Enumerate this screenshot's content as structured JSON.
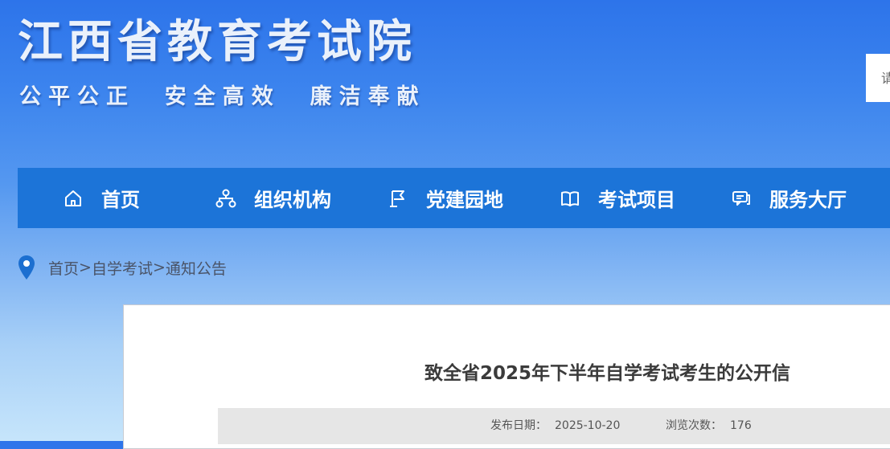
{
  "header": {
    "site_title": "江西省教育考试院",
    "slogan": "公平公正  安全高效  廉洁奉献",
    "search_placeholder": "请"
  },
  "nav": {
    "items": [
      {
        "label": "首页",
        "icon": "home-icon"
      },
      {
        "label": "组织机构",
        "icon": "org-chart-icon"
      },
      {
        "label": "党建园地",
        "icon": "party-flag-icon"
      },
      {
        "label": "考试项目",
        "icon": "book-icon"
      },
      {
        "label": "服务大厅",
        "icon": "service-icon"
      }
    ]
  },
  "breadcrumb": {
    "icon": "location-pin-icon",
    "items": [
      "首页",
      "自学考试",
      "通知公告"
    ],
    "separator": ">"
  },
  "article": {
    "title": "致全省2025年下半年自学考试考生的公开信",
    "publish_label": "发布日期：",
    "publish_date": "2025-10-20",
    "views_label": "浏览次数：",
    "views": "176"
  },
  "colors": {
    "nav_background": "#1c74d8",
    "header_top": "#2d74ea",
    "page_bottom": "#c6e5fb",
    "breadcrumb_pin": "#1c6fd0"
  }
}
